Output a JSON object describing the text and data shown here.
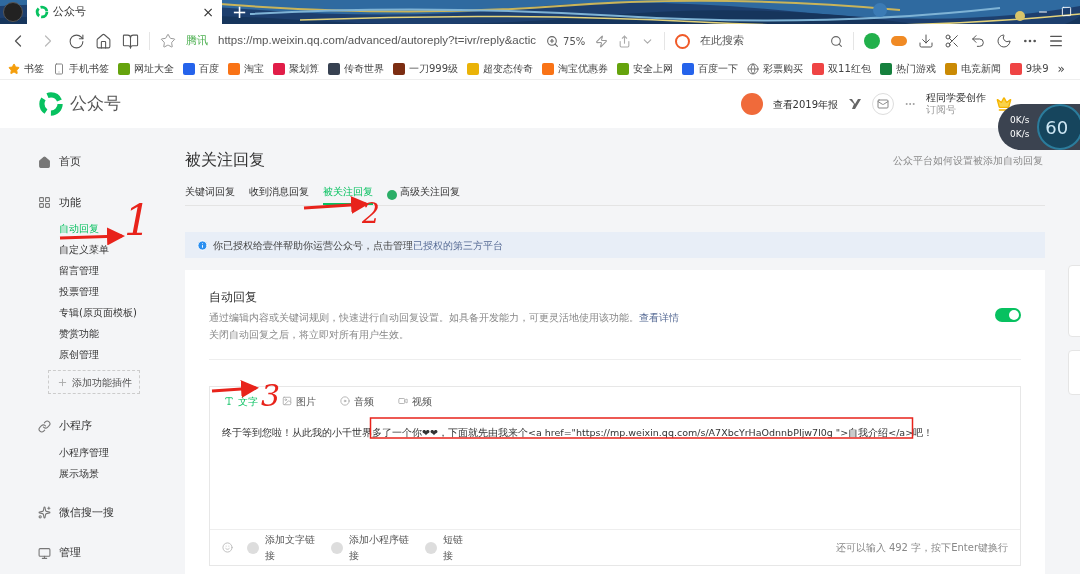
{
  "browser": {
    "tab": {
      "title": "公众号",
      "close": "×"
    },
    "new_tab": "+",
    "address": {
      "site_label": "腾讯",
      "url": "https://mp.weixin.qq.com/advanced/autoreply?t=ivr/reply&actic",
      "zoom": "75%"
    },
    "search": {
      "placeholder": "在此搜索"
    },
    "bookmarks": [
      "书签",
      "手机书签",
      "网址大全",
      "百度",
      "淘宝",
      "聚划算",
      "传奇世界",
      "一刀999级",
      "超变态传奇",
      "淘宝优惠券",
      "安全上网",
      "百度一下",
      "彩票购买",
      "双11红包",
      "热门游戏",
      "电竞新闻",
      "9块9"
    ],
    "bookmarks_more": "»"
  },
  "header": {
    "logo": "公众号",
    "annual_report": "查看2019年报",
    "account_name": "程同学爱创作",
    "account_type": "订阅号"
  },
  "speed_widget": {
    "upload": "0K/s",
    "download": "0K/s",
    "score": "60"
  },
  "sidebar": {
    "sections": [
      {
        "label": "首页"
      },
      {
        "label": "功能",
        "items": [
          {
            "label": "自动回复",
            "selected": true
          },
          {
            "label": "自定义菜单",
            "selected": false
          },
          {
            "label": "留言管理",
            "selected": false
          },
          {
            "label": "投票管理",
            "selected": false
          },
          {
            "label": "专辑(原页面模板)",
            "selected": false
          },
          {
            "label": "赞赏功能",
            "selected": false
          },
          {
            "label": "原创管理",
            "selected": false
          }
        ],
        "add_plugin": "添加功能插件"
      },
      {
        "label": "小程序",
        "items": [
          {
            "label": "小程序管理",
            "selected": false
          },
          {
            "label": "展示场景",
            "selected": false
          }
        ]
      },
      {
        "label": "微信搜一搜"
      },
      {
        "label": "管理"
      }
    ]
  },
  "page": {
    "title": "被关注回复",
    "help_link": "公众平台如何设置被添加自动回复",
    "tabs": [
      {
        "label": "关键词回复",
        "selected": false
      },
      {
        "label": "收到消息回复",
        "selected": false
      },
      {
        "label": "被关注回复",
        "selected": true
      },
      {
        "label": "高级关注回复",
        "selected": false
      }
    ],
    "notice": {
      "text": "你已授权给壹伴帮助你运营公众号，点击管理",
      "link": "已授权的第三方平台"
    }
  },
  "auto_reply": {
    "title": "自动回复",
    "description": "通过编辑内容或关键词规则，快速进行自动回复设置。如具备开发能力，可更灵活地使用该功能。",
    "details_link": "查看详情",
    "note": "关闭自动回复之后，将立即对所有用户生效。",
    "enabled": true
  },
  "editor": {
    "types": [
      {
        "label": "文字",
        "selected": true
      },
      {
        "label": "图片",
        "selected": false
      },
      {
        "label": "音频",
        "selected": false
      },
      {
        "label": "视频",
        "selected": false
      }
    ],
    "content": "终于等到您啦！从此我的小千世界多了一个你❤❤，下面就先由我来个<a href=\"https://mp.weixin.qq.com/s/A7XbcYrHaOdnnbPIjw7l0g \">自我介绍</a>吧！",
    "tools": [
      "添加文字链接",
      "添加小程序链接",
      "短链接"
    ],
    "counter": "还可以输入 492 字，按下Enter键换行"
  },
  "annotations": [
    "1",
    "2",
    "3"
  ]
}
